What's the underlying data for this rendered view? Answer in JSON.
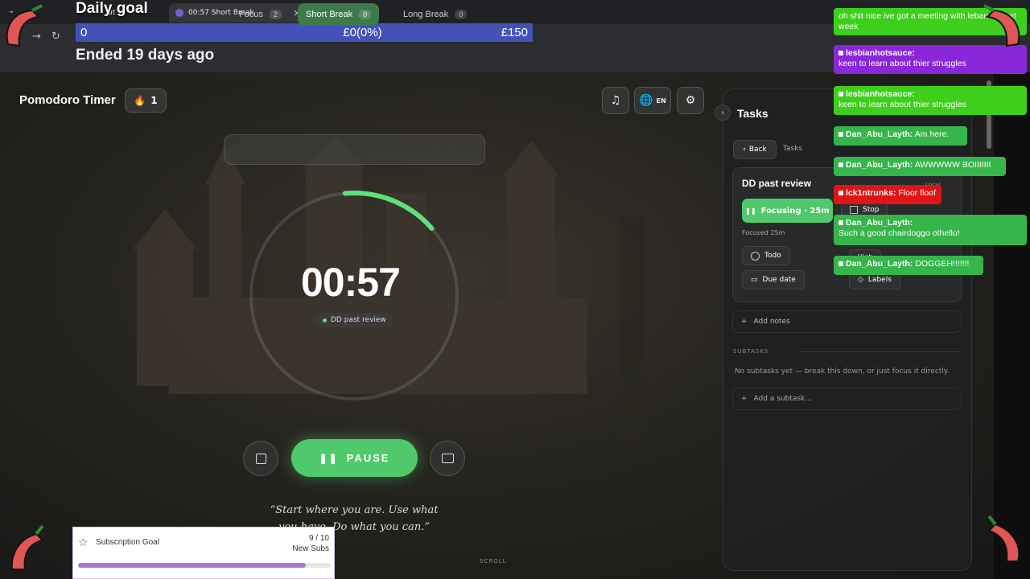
{
  "browser": {
    "tab_partial_label": "ut",
    "tab_label": "00:57 Short Break"
  },
  "donation_goal": {
    "title": "Daily goal",
    "start": "0",
    "progress": "£0(0%)",
    "target": "£150",
    "status": "Ended 19 days ago"
  },
  "app": {
    "title": "Pomodoro Timer",
    "streak_count": "1",
    "language": "EN",
    "modes": [
      {
        "label": "Focus",
        "count": "2"
      },
      {
        "label": "Short Break",
        "count": "0"
      },
      {
        "label": "Long Break",
        "count": "0"
      }
    ],
    "timer": "00:57",
    "timer_progress": 0.15,
    "current_task": "DD past review",
    "pause_label": "PAUSE",
    "quote_line1": "“Start where you are. Use what",
    "quote_line2": "you have. Do what you can.”",
    "scroll_label": "SCROLL"
  },
  "tasks": {
    "title": "Tasks",
    "back": "Back",
    "breadcrumb": "Tasks",
    "task_title": "DD past review",
    "focusing": "Focusing · 25m",
    "focused": "Focused 25m",
    "local": "Local",
    "stop": "Stop",
    "priority": "High",
    "todo": "Todo",
    "due_date": "Due date",
    "labels": "Labels",
    "add_notes": "Add notes",
    "subtasks_heading": "SUBTASKS",
    "no_subtasks": "No subtasks yet — break this down, or just focus it directly.",
    "add_subtask": "Add a subtask..."
  },
  "chat": [
    {
      "user": "",
      "text": "oh shit nice ive got a meeting with lebanon next week",
      "color": "#3ecf1c"
    },
    {
      "user": "lesbianhotsauce:",
      "text": "keen to learn about thier struggles",
      "color": "#8a28d9"
    },
    {
      "user": "lesbianhotsauce:",
      "text": "keen to learn about thier struggles",
      "color": "#3ecf1c"
    },
    {
      "user": "Dan_Abu_Layth:",
      "text": "Am here.",
      "color": "#35b54a"
    },
    {
      "user": "Dan_Abu_Layth:",
      "text": "AWWWWW BOIIIIIII",
      "color": "#35b54a"
    },
    {
      "user": "lck1ntrunks:",
      "text": "Floor floof",
      "color": "#e01414"
    },
    {
      "user": "Dan_Abu_Layth:",
      "text": "Such a good chairdoggo othello!",
      "color": "#35b54a"
    },
    {
      "user": "Dan_Abu_Layth:",
      "text": "DOGGEH!!!!!!!",
      "color": "#35b54a"
    }
  ],
  "sub_goal": {
    "title": "Subscription Goal",
    "count": "9 / 10",
    "unit": "New Subs",
    "progress": 0.9
  },
  "colors": {
    "accent": "#4fc96a",
    "goal_bar": "#4452b8"
  }
}
